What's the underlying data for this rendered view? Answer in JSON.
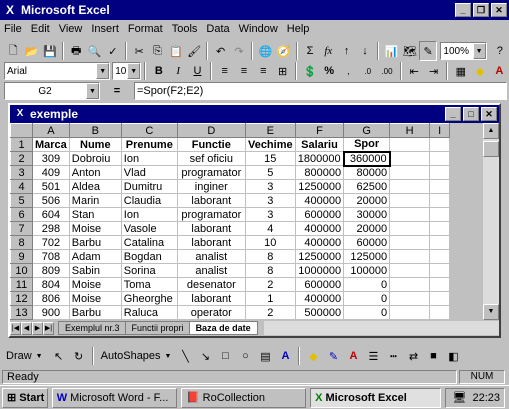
{
  "app": {
    "title": "Microsoft Excel"
  },
  "menu": [
    "File",
    "Edit",
    "View",
    "Insert",
    "Format",
    "Tools",
    "Data",
    "Window",
    "Help"
  ],
  "toolbar": {
    "zoom": "100%",
    "font": "Arial",
    "size": "10",
    "bold": "B",
    "italic": "I",
    "underline": "U",
    "percent": "%",
    "sigma": "Σ",
    "fx": "fx"
  },
  "formula": {
    "cell": "G2",
    "eq": "=",
    "text": "=Spor(F2;E2)"
  },
  "doc": {
    "title": "exemple"
  },
  "columns": [
    "A",
    "B",
    "C",
    "D",
    "E",
    "F",
    "G",
    "H",
    "I"
  ],
  "headers": [
    "Marca",
    "Nume",
    "Prenume",
    "Functie",
    "Vechime",
    "Salariu",
    "Spor"
  ],
  "rows": [
    [
      "309",
      "Dobroiu",
      "Ion",
      "sef oficiu",
      "15",
      "1800000",
      "360000"
    ],
    [
      "409",
      "Anton",
      "Vlad",
      "programator",
      "5",
      "800000",
      "80000"
    ],
    [
      "501",
      "Aldea",
      "Dumitru",
      "inginer",
      "3",
      "1250000",
      "62500"
    ],
    [
      "506",
      "Marin",
      "Claudia",
      "laborant",
      "3",
      "400000",
      "20000"
    ],
    [
      "604",
      "Stan",
      "Ion",
      "programator",
      "3",
      "600000",
      "30000"
    ],
    [
      "298",
      "Moise",
      "Vasole",
      "laborant",
      "4",
      "400000",
      "20000"
    ],
    [
      "702",
      "Barbu",
      "Catalina",
      "laborant",
      "10",
      "400000",
      "60000"
    ],
    [
      "708",
      "Adam",
      "Bogdan",
      "analist",
      "8",
      "1250000",
      "125000"
    ],
    [
      "809",
      "Sabin",
      "Sorina",
      "analist",
      "8",
      "1000000",
      "100000"
    ],
    [
      "804",
      "Moise",
      "Toma",
      "desenator",
      "2",
      "600000",
      "0"
    ],
    [
      "806",
      "Moise",
      "Gheorghe",
      "laborant",
      "1",
      "400000",
      "0"
    ],
    [
      "900",
      "Barbu",
      "Raluca",
      "operator",
      "2",
      "500000",
      "0"
    ]
  ],
  "rownums": [
    "1",
    "2",
    "3",
    "4",
    "5",
    "6",
    "7",
    "8",
    "9",
    "10",
    "11",
    "12",
    "13"
  ],
  "sheets": [
    "Exemplul nr.3",
    "Functii propri",
    "Baza de date"
  ],
  "drawbar": {
    "draw": "Draw",
    "autoshapes": "AutoShapes"
  },
  "status": {
    "ready": "Ready",
    "num": "NUM"
  },
  "taskbar": {
    "start": "Start",
    "tasks": [
      "Microsoft Word - F...",
      "RoCollection",
      "Microsoft Excel"
    ],
    "time": "22:23"
  }
}
